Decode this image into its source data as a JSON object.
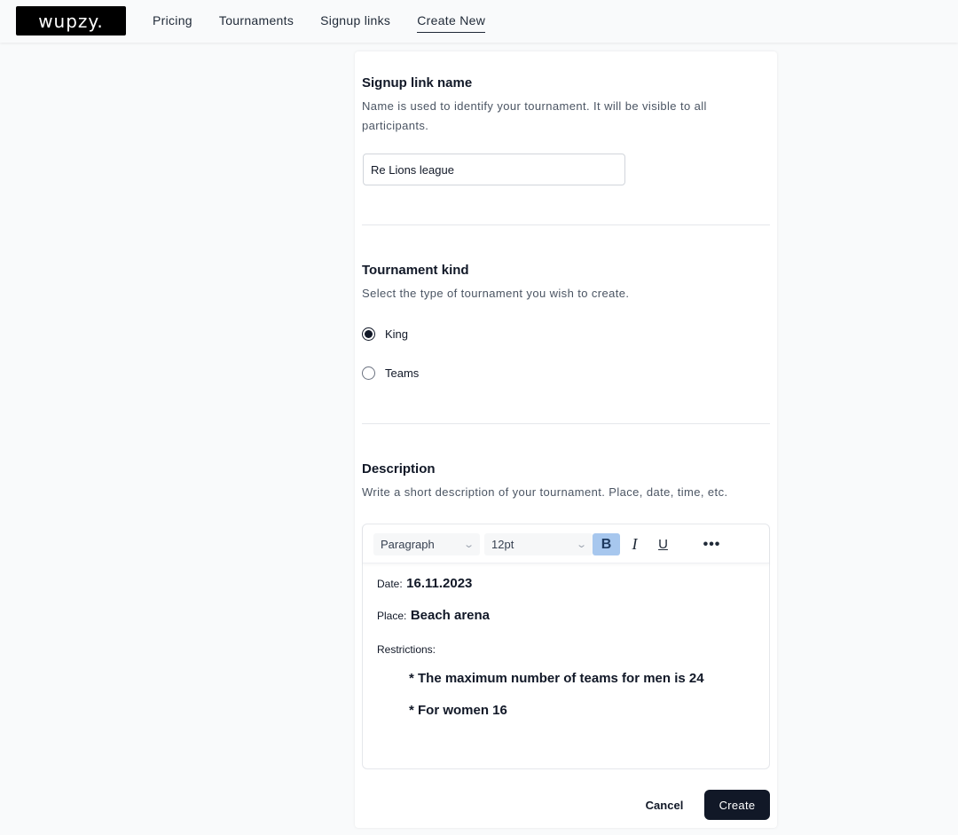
{
  "header": {
    "logo": "wupzy.",
    "nav": [
      {
        "label": "Pricing",
        "active": false
      },
      {
        "label": "Tournaments",
        "active": false
      },
      {
        "label": "Signup links",
        "active": false
      },
      {
        "label": "Create New",
        "active": true
      }
    ]
  },
  "form": {
    "name_section": {
      "title": "Signup link name",
      "description": "Name is used to identify your tournament. It will be visible to all participants.",
      "input_value": "Re Lions league"
    },
    "kind_section": {
      "title": "Tournament kind",
      "description": "Select the type of tournament you wish to create.",
      "options": [
        {
          "label": "King",
          "checked": true
        },
        {
          "label": "Teams",
          "checked": false
        }
      ]
    },
    "description_section": {
      "title": "Description",
      "description": "Write a short description of your tournament. Place, date, time, etc.",
      "toolbar": {
        "block_format": "Paragraph",
        "font_size": "12pt",
        "bold_active": true,
        "bold_label": "B",
        "italic_label": "I",
        "underline_label": "U",
        "more_label": "•••"
      },
      "content": {
        "date_label": "Date:",
        "date_value": "16.11.2023",
        "place_label": "Place:",
        "place_value": "Beach arena",
        "restrictions_label": "Restrictions:",
        "bullets": [
          "* The maximum number of teams for men is 24",
          "* For women 16"
        ]
      }
    },
    "actions": {
      "cancel_label": "Cancel",
      "create_label": "Create"
    }
  },
  "colors": {
    "primary": "#111827",
    "bold_active_bg": "#a7c7ee",
    "page_bg": "#f9fafb"
  }
}
